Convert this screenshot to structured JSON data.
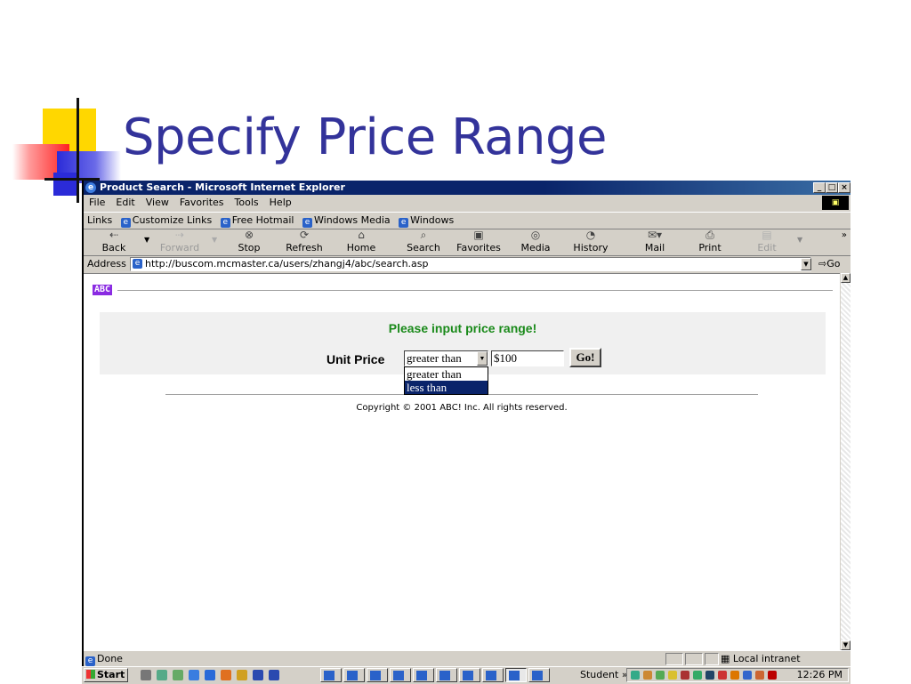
{
  "slide": {
    "title": "Specify Price Range"
  },
  "window": {
    "title": "Product Search - Microsoft Internet Explorer",
    "controls": {
      "minimize": "_",
      "maximize": "□",
      "close": "×"
    }
  },
  "menu": [
    "File",
    "Edit",
    "View",
    "Favorites",
    "Tools",
    "Help"
  ],
  "links_bar": {
    "label": "Links",
    "items": [
      "Customize Links",
      "Free Hotmail",
      "Windows Media",
      "Windows"
    ]
  },
  "toolbar": {
    "back": "Back",
    "forward": "Forward",
    "stop": "Stop",
    "refresh": "Refresh",
    "home": "Home",
    "search": "Search",
    "favorites": "Favorites",
    "media": "Media",
    "history": "History",
    "mail": "Mail",
    "print": "Print",
    "edit": "Edit",
    "more": "»"
  },
  "address": {
    "label": "Address",
    "url": "http://buscom.mcmaster.ca/users/zhangj4/abc/search.asp",
    "go": "Go"
  },
  "page": {
    "logo": "ABC",
    "prompt": "Please input price range!",
    "unit_price_label": "Unit Price",
    "operator_selected": "greater than",
    "operator_options": [
      "greater than",
      "less than"
    ],
    "highlighted_option": "less than",
    "price_value": "$100",
    "go_button": "Go!",
    "copyright": "Copyright © 2001 ABC! Inc. All rights reserved."
  },
  "status": {
    "text": "Done",
    "zone": "Local intranet"
  },
  "taskbar": {
    "start": "Start",
    "student": "Student",
    "chevron": "»",
    "clock": "12:26 PM"
  },
  "colors": {
    "title_text": "#33339a",
    "ie_titlebar": "#0a246a",
    "prompt_green": "#1a8a1a",
    "selection_blue": "#0a246a",
    "abc_logo": "#8a2be2"
  }
}
